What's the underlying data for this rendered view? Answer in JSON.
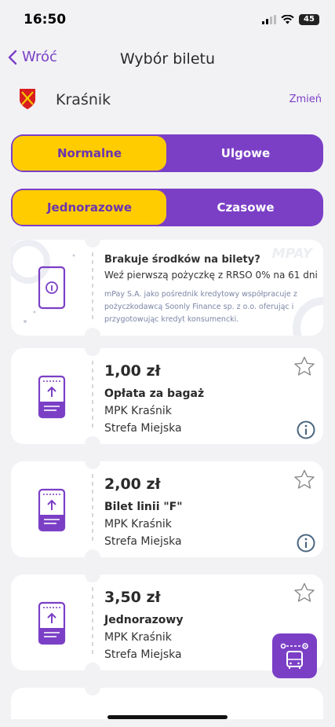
{
  "status": {
    "time": "16:50",
    "battery": "45"
  },
  "nav": {
    "back_label": "Wróć",
    "title": "Wybór biletu"
  },
  "city": {
    "name": "Kraśnik",
    "change_label": "Zmień"
  },
  "segment_type": {
    "left": "Normalne",
    "right": "Ulgowe",
    "selected": "Normalne"
  },
  "segment_kind": {
    "left": "Jednorazowe",
    "right": "Czasowe",
    "selected": "Jednorazowe"
  },
  "promo": {
    "brand": "MPAY",
    "title": "Brakuje środków na bilety?",
    "subtitle": "Weź pierwszą pożyczkę z RRSO 0% na 61 dni",
    "description": "mPay S.A. jako pośrednik kredytowy współpracuje z pożyczkodawcą Soonly Finance sp. z o.o. oferując i przygotowując kredyt konsumencki."
  },
  "tickets": [
    {
      "price": "1,00 zł",
      "name": "Opłata za bagaż",
      "carrier": "MPK Kraśnik",
      "zone": "Strefa Miejska"
    },
    {
      "price": "2,00 zł",
      "name": "Bilet linii \"F\"",
      "carrier": "MPK Kraśnik",
      "zone": "Strefa Miejska"
    },
    {
      "price": "3,50 zł",
      "name": "Jednorazowy",
      "carrier": "MPK Kraśnik",
      "zone": "Strefa Miejska"
    }
  ],
  "colors": {
    "accent": "#7b3fc6",
    "selected": "#ffcc00",
    "background": "#f2f2f5"
  },
  "icons": {
    "back": "chevron-left-icon",
    "star": "star-outline-icon",
    "info": "info-circle-icon",
    "ticket": "ticket-icon",
    "fab": "bus-map-icon"
  }
}
